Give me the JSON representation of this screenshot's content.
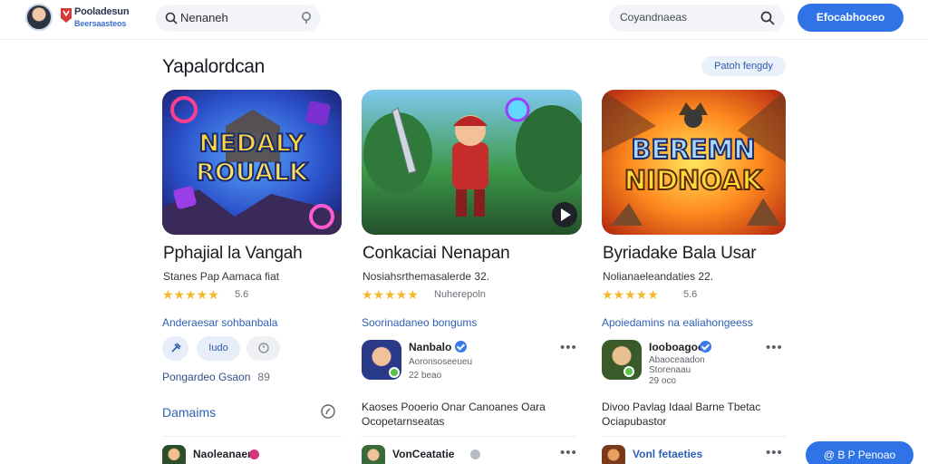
{
  "header": {
    "brand_line1": "Pooladesun",
    "brand_line2": "Beersaasteos",
    "search_value": "Nenaneh",
    "search_right_placeholder": "Coyandnaeas",
    "primary_button": "Efocabhoceo"
  },
  "section": {
    "title": "Yapalordcan",
    "chip": "Patoh fengdy"
  },
  "cards": [
    {
      "art_text": [
        "NEDALY",
        "ROUALK"
      ],
      "title": "Pphajial la Vangah",
      "subtitle": "Stanes Pap Aamaca fiat",
      "rating": "5.6",
      "link": "Anderaesar sohbanbala",
      "pills": [
        "",
        "Iudo",
        ""
      ],
      "inline_label": "Pongardeo Gsaon",
      "inline_num": "89",
      "section2": "Damaims"
    },
    {
      "title": "Conkaciai Nenapan",
      "subtitle": "Nosiahsrthemasalerde 32.",
      "rating": "Nuherepoln",
      "link": "Soorinadaneo bongums",
      "review": {
        "name": "Nanbalo",
        "meta": "Aoronsoseeueu",
        "date": "22 beao"
      },
      "review_body": [
        "Kaoses Pooerio  Onar Canoanes Oara",
        "Ocopetarnseatas"
      ],
      "bottom_name": "VonCeatatie"
    },
    {
      "art_text": [
        "BEREMN",
        "NIDNOAK"
      ],
      "title": "Byriadake Bala Usar",
      "subtitle": "Nolianaeleandaties  22.",
      "rating": "5.6",
      "link": "Apoiedamins na ealiahongeess",
      "review": {
        "name": "Iooboagoell",
        "meta": "Abaoceaadon\nStorenaau",
        "date": "29 oco"
      },
      "review_body": [
        "Divoo Pavlag Idaal  Barne Tbetac",
        "Ociapubastor"
      ],
      "bottom_name": "Vonl fetaeties"
    }
  ],
  "fab": "@ B P Penoao",
  "colors": {
    "accent": "#2f73e6",
    "star": "#f3b92a",
    "link": "#2d5fb5"
  }
}
